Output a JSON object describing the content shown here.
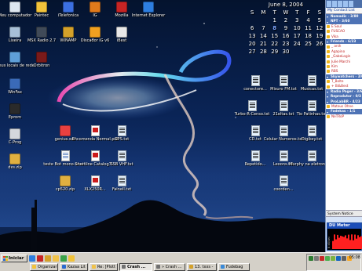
{
  "desktop_icons": [
    {
      "label": "Meu computador",
      "icon": "my-computer-icon",
      "color": "#dde6f0"
    },
    {
      "label": "Paintec",
      "icon": "paint-icon",
      "color": "#f2c33b"
    },
    {
      "label": "iTelefonica",
      "icon": "phone-icon",
      "color": "#3b6fe0"
    },
    {
      "label": "IG",
      "icon": "ig-icon",
      "color": "#e07a1b"
    },
    {
      "label": "Mozilla",
      "icon": "mozilla-icon",
      "color": "#c62424"
    },
    {
      "label": "Internet Explorer",
      "icon": "internet-explorer-icon",
      "color": "#2d7ee0"
    },
    {
      "label": "Lixeira",
      "icon": "recycle-bin-icon",
      "color": "#a8c0d8"
    },
    {
      "label": "MSX Radio 2.7",
      "icon": "radio-icon",
      "color": "#404a58"
    },
    {
      "label": "WINAMP",
      "icon": "winamp-icon",
      "color": "#d4a12a"
    },
    {
      "label": "Discador iG v6",
      "icon": "dialer-icon",
      "color": "#f0a020"
    },
    {
      "label": "iBest",
      "icon": "ibest-icon",
      "color": "#e8e8e8"
    },
    {
      "label": "Meus locais de rede",
      "icon": "network-places-icon",
      "color": "#5f9fd8"
    },
    {
      "label": "Orbitron",
      "icon": "orbitron-icon",
      "color": "#7a1a1a"
    },
    {
      "label": "WinFax",
      "icon": "fax-icon",
      "color": "#3a6ab8"
    },
    {
      "label": "Eprom",
      "icon": "chip-icon",
      "color": "#2a2a2a"
    },
    {
      "label": "C-Prog",
      "icon": "code-icon",
      "color": "#d5d8dd"
    },
    {
      "label": "dxs.zip",
      "icon": "zip-icon",
      "color": "#e0b040"
    },
    {
      "label": "genius.swf",
      "icon": "flash-icon",
      "color": "#e84040"
    },
    {
      "label": "Encomenda Normal.pdf",
      "icon": "pdf-icon",
      "color": "#ffffff"
    },
    {
      "label": "GPS.txt",
      "icon": "text-file-icon",
      "color": "#e6f3ff"
    },
    {
      "label": "teste Bot mono-unsi...",
      "icon": "document-icon",
      "color": "#ffffff"
    },
    {
      "label": "Shortline Catalog7...",
      "icon": "pdf-icon",
      "color": "#ffffff"
    },
    {
      "label": "SSB VHF.txt",
      "icon": "text-file-icon",
      "color": "#e6f3ff"
    },
    {
      "label": "cp520.zip",
      "icon": "zip-icon",
      "color": "#e0b040"
    },
    {
      "label": "XLX250R...",
      "icon": "pdf-icon",
      "color": "#ffffff"
    },
    {
      "label": "Fainell.txt",
      "icon": "text-file-icon",
      "color": "#e6f3ff"
    },
    {
      "label": "conectore...",
      "icon": "text-file-icon",
      "color": "#e6f3ff"
    },
    {
      "label": "Misuro FM.txt",
      "icon": "text-file-icon",
      "color": "#e6f3ff"
    },
    {
      "label": "Musicas.txt",
      "icon": "text-file-icon",
      "color": "#e6f3ff"
    },
    {
      "label": "Turbo-R-Censo.txt",
      "icon": "text-file-icon",
      "color": "#e6f3ff"
    },
    {
      "label": "21eltas.txt",
      "icon": "text-file-icon",
      "color": "#e6f3ff"
    },
    {
      "label": "Tio Patinhas.txt",
      "icon": "text-file-icon",
      "color": "#e6f3ff"
    },
    {
      "label": "CD.txt",
      "icon": "text-file-icon",
      "color": "#e6f3ff"
    },
    {
      "label": "Celular Numeros.txt",
      "icon": "text-file-icon",
      "color": "#e6f3ff"
    },
    {
      "label": "Digikey.txt",
      "icon": "text-file-icon",
      "color": "#e6f3ff"
    },
    {
      "label": "Repetido...",
      "icon": "text-file-icon",
      "color": "#e6f3ff"
    },
    {
      "label": "Leoons.txt",
      "icon": "text-file-icon",
      "color": "#e6f3ff"
    },
    {
      "label": "Murphy na eletronica...",
      "icon": "text-file-icon",
      "color": "#e6f3ff"
    },
    {
      "label": "coorden...",
      "icon": "text-file-icon",
      "color": "#e6f3ff"
    }
  ],
  "calendar": {
    "title": "June 8, 2004",
    "weekdays": [
      "S",
      "M",
      "T",
      "W",
      "T",
      "F",
      "S"
    ],
    "weeks": [
      [
        "",
        "",
        "1",
        "2",
        "3",
        "4",
        "5"
      ],
      [
        "6",
        "7",
        "8",
        "9",
        "10",
        "11",
        "12"
      ],
      [
        "13",
        "14",
        "15",
        "16",
        "17",
        "18",
        "19"
      ],
      [
        "20",
        "21",
        "22",
        "23",
        "24",
        "25",
        "26"
      ],
      [
        "27",
        "28",
        "29",
        "30",
        "",
        "",
        ""
      ]
    ],
    "today": "8"
  },
  "sidebar": {
    "header": "My Contact List",
    "contacts": [
      {
        "name": "Nomadic - 3/80",
        "group": true
      },
      {
        "name": "NPT - 3/60",
        "group": true
      },
      {
        "name": "E Soul",
        "group": false
      },
      {
        "name": "FUSCAO",
        "group": false
      },
      {
        "name": "Vika",
        "group": false
      },
      {
        "name": "Friends - 6/23",
        "group": true
      },
      {
        "name": "_ anih",
        "group": false
      },
      {
        "name": "Agapino",
        "group": false
      },
      {
        "name": "_GabeLogin",
        "group": false
      },
      {
        "name": "Julie Marchi",
        "group": false
      },
      {
        "name": "Kim",
        "group": false
      },
      {
        "name": "RBS",
        "group": false
      },
      {
        "name": "Skywatchers - 3/05",
        "group": true
      },
      {
        "name": "T_Bolte",
        "group": false
      },
      {
        "name": "+ Bi&Best",
        "group": false
      },
      {
        "name": "Radio Pager - 3/62",
        "group": true
      },
      {
        "name": "Reprodutor - 0/3",
        "group": true
      },
      {
        "name": "ProLabBR - 4/23",
        "group": true
      },
      {
        "name": "Mateus Ohne",
        "group": false
      },
      {
        "name": "Fadekas - 1/1",
        "group": true
      },
      {
        "name": "NeTRoP",
        "group": false
      }
    ],
    "status": "System Notice",
    "du_meter_title": "DU Meter",
    "du_meter_axis": "8 kB/sec",
    "du_meter_level": 0.72,
    "du_meter_color": "#ff2020"
  },
  "taskbar": {
    "start_label": "Iniciar",
    "quicklaunch": [
      {
        "icon": "ie-icon",
        "color": "#2d7ee0"
      },
      {
        "icon": "mozilla-icon",
        "color": "#c62424"
      },
      {
        "icon": "winamp-icon",
        "color": "#d4a12a"
      },
      {
        "icon": "mail-icon",
        "color": "#f0c24a"
      },
      {
        "icon": "media-icon",
        "color": "#3aa34a"
      },
      {
        "icon": "folder-icon",
        "color": "#f2c33b"
      }
    ],
    "tasks_row1": [],
    "tasks_row2": [
      {
        "label": "Organizar",
        "icon": "folder-icon",
        "color": "#f2c33b",
        "active": false
      },
      {
        "label": "Kazaa Lit",
        "icon": "kazaa-icon",
        "color": "#2a6ad0",
        "active": false
      },
      {
        "label": "Re: [Plott",
        "icon": "mail-icon",
        "color": "#f0c24a",
        "active": false
      },
      {
        "label": "Crash ...",
        "icon": "crash-icon",
        "color": "#707070",
        "active": true
      },
      {
        "label": "» Crash ...",
        "icon": "crash-icon",
        "color": "#707070",
        "active": false
      },
      {
        "label": "13. txxs -",
        "icon": "winamp-icon",
        "color": "#d4a12a",
        "active": false
      },
      {
        "label": "Fudebag",
        "icon": "paint-icon",
        "color": "#3a8ad8",
        "active": false
      }
    ],
    "tray_icons": [
      {
        "icon": "network-icon",
        "color": "#2e7d32"
      },
      {
        "icon": "volume-icon",
        "color": "#7a7a7a"
      },
      {
        "icon": "antivirus-icon",
        "color": "#c62828"
      },
      {
        "icon": "msn-icon",
        "color": "#4caf50"
      },
      {
        "icon": "icq-icon",
        "color": "#7cb342"
      },
      {
        "icon": "shield-icon",
        "color": "#1565c0"
      },
      {
        "icon": "printer-icon",
        "color": "#616161"
      },
      {
        "icon": "battery-icon",
        "color": "#f9a825"
      }
    ],
    "clock": "05:08"
  }
}
